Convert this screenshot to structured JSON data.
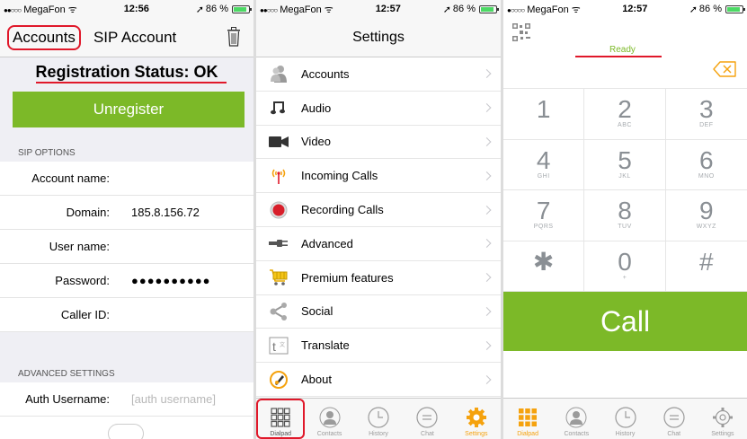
{
  "colors": {
    "accent_green": "#7cb928",
    "highlight_red": "#e0182a",
    "settings_orange": "#f5a20e"
  },
  "panel1": {
    "status": {
      "carrier": "MegaFon",
      "time": "12:56",
      "battery": "86 %",
      "battery_level": 0.86
    },
    "nav": {
      "back": "Accounts",
      "title": "SIP Account",
      "trash_icon": "trash-icon"
    },
    "registration_status": "Registration Status: OK",
    "unregister_label": "Unregister",
    "sip_options_header": "SIP OPTIONS",
    "fields": [
      {
        "label": "Account name:",
        "value": ""
      },
      {
        "label": "Domain:",
        "value": "185.8.156.72"
      },
      {
        "label": "User name:",
        "value": ""
      },
      {
        "label": "Password:",
        "value": "●●●●●●●●●●"
      },
      {
        "label": "Caller ID:",
        "value": ""
      }
    ],
    "advanced_header": "ADVANCED SETTINGS",
    "auth": {
      "label": "Auth Username:",
      "placeholder": "[auth username]"
    }
  },
  "panel2": {
    "status": {
      "carrier": "MegaFon",
      "time": "12:57",
      "battery": "86 %",
      "battery_level": 0.86
    },
    "title": "Settings",
    "menu": [
      {
        "label": "Accounts",
        "icon": "accounts-icon"
      },
      {
        "label": "Audio",
        "icon": "music-note-icon"
      },
      {
        "label": "Video",
        "icon": "video-camera-icon"
      },
      {
        "label": "Incoming Calls",
        "icon": "antenna-icon"
      },
      {
        "label": "Recording Calls",
        "icon": "record-icon"
      },
      {
        "label": "Advanced",
        "icon": "plug-icon"
      },
      {
        "label": "Premium features",
        "icon": "cart-icon"
      },
      {
        "label": "Social",
        "icon": "share-icon"
      },
      {
        "label": "Translate",
        "icon": "translate-icon"
      },
      {
        "label": "About",
        "icon": "about-icon"
      }
    ],
    "tabs": [
      {
        "label": "Dialpad",
        "icon": "dialpad-icon"
      },
      {
        "label": "Contacts",
        "icon": "contacts-icon"
      },
      {
        "label": "History",
        "icon": "clock-icon"
      },
      {
        "label": "Chat",
        "icon": "chat-icon"
      },
      {
        "label": "Settings",
        "icon": "gear-icon"
      }
    ]
  },
  "panel3": {
    "status": {
      "carrier": "MegaFon",
      "time": "12:57",
      "battery": "86 %",
      "battery_level": 0.86
    },
    "ready": "Ready",
    "keys": [
      {
        "digit": "1",
        "letters": ""
      },
      {
        "digit": "2",
        "letters": "ABC"
      },
      {
        "digit": "3",
        "letters": "DEF"
      },
      {
        "digit": "4",
        "letters": "GHI"
      },
      {
        "digit": "5",
        "letters": "JKL"
      },
      {
        "digit": "6",
        "letters": "MNO"
      },
      {
        "digit": "7",
        "letters": "PQRS"
      },
      {
        "digit": "8",
        "letters": "TUV"
      },
      {
        "digit": "9",
        "letters": "WXYZ"
      },
      {
        "digit": "✱",
        "letters": ""
      },
      {
        "digit": "0",
        "letters": "+"
      },
      {
        "digit": "#",
        "letters": ""
      }
    ],
    "call_label": "Call",
    "tabs": [
      {
        "label": "Dialpad",
        "icon": "dialpad-icon"
      },
      {
        "label": "Contacts",
        "icon": "contacts-icon"
      },
      {
        "label": "History",
        "icon": "clock-icon"
      },
      {
        "label": "Chat",
        "icon": "chat-icon"
      },
      {
        "label": "Settings",
        "icon": "gear-icon"
      }
    ]
  }
}
